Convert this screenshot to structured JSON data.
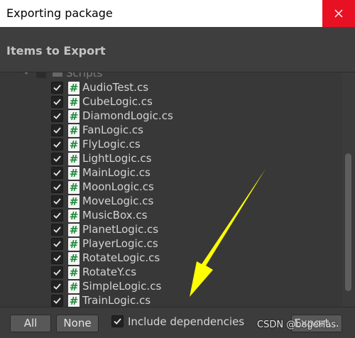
{
  "window": {
    "title": "Exporting package",
    "close_icon": "close-icon",
    "close_color": "#e81123"
  },
  "header": {
    "title": "Items to Export"
  },
  "tree": {
    "folder": {
      "label": "Scripts",
      "checked": true,
      "icon": "folder-icon"
    },
    "files": [
      {
        "name": "AudioTest.cs",
        "checked": true,
        "icon": "csharp-script-icon"
      },
      {
        "name": "CubeLogic.cs",
        "checked": true,
        "icon": "csharp-script-icon"
      },
      {
        "name": "DiamondLogic.cs",
        "checked": true,
        "icon": "csharp-script-icon"
      },
      {
        "name": "FanLogic.cs",
        "checked": true,
        "icon": "csharp-script-icon"
      },
      {
        "name": "FlyLogic.cs",
        "checked": true,
        "icon": "csharp-script-icon"
      },
      {
        "name": "LightLogic.cs",
        "checked": true,
        "icon": "csharp-script-icon"
      },
      {
        "name": "MainLogic.cs",
        "checked": true,
        "icon": "csharp-script-icon"
      },
      {
        "name": "MoonLogic.cs",
        "checked": true,
        "icon": "csharp-script-icon"
      },
      {
        "name": "MoveLogic.cs",
        "checked": true,
        "icon": "csharp-script-icon"
      },
      {
        "name": "MusicBox.cs",
        "checked": true,
        "icon": "csharp-script-icon"
      },
      {
        "name": "PlanetLogic.cs",
        "checked": true,
        "icon": "csharp-script-icon"
      },
      {
        "name": "PlayerLogic.cs",
        "checked": true,
        "icon": "csharp-script-icon"
      },
      {
        "name": "RotateLogic.cs",
        "checked": true,
        "icon": "csharp-script-icon"
      },
      {
        "name": "RotateY.cs",
        "checked": true,
        "icon": "csharp-script-icon"
      },
      {
        "name": "SimpleLogic.cs",
        "checked": true,
        "icon": "csharp-script-icon"
      },
      {
        "name": "TrainLogic.cs",
        "checked": true,
        "icon": "csharp-script-icon"
      }
    ],
    "file_glyph": "#"
  },
  "footer": {
    "all_label": "All",
    "none_label": "None",
    "include_dependencies_label": "Include dependencies",
    "include_dependencies_checked": true,
    "export_label": "Export...",
    "watermark": "CSDN @bogeHas"
  },
  "annotation": {
    "arrow_color": "#ffff00",
    "icon": "arrow-annotation"
  }
}
